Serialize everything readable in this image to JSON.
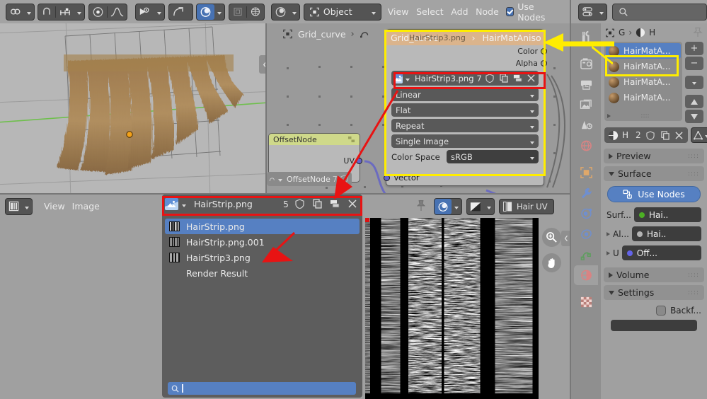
{
  "topbar": {
    "editor_icons": [
      "link-icon",
      "magnet-icon",
      "snap-icon",
      "proportional-edit-icon",
      "falloff-curve-icon",
      "visibility-icon",
      "pivot-icon",
      "overlay-icon",
      "xray-icon",
      "shading-icon"
    ],
    "shading_label": "",
    "mode_selector": "Object",
    "menus": [
      "View",
      "Select",
      "Add",
      "Node"
    ],
    "use_nodes_label": "Use Nodes",
    "use_nodes_checked": true,
    "right_editor_icon": "properties-editor-icon",
    "search_placeholder": ""
  },
  "viewport": {
    "collapse_icon": "chevron-left-icon"
  },
  "node_editor": {
    "breadcrumb": {
      "object_icon": "object-icon",
      "object": "Grid_curve",
      "arrow": "›",
      "modifier_icon": "nodetree-icon"
    },
    "header_path": {
      "left": "Grid_curve",
      "overlay": "HairStrip3.png",
      "sep": "›",
      "material": "HairMatAniso",
      "material_icon": "material-sphere-icon"
    },
    "image_node": {
      "outputs": [
        "Color",
        "Alpha"
      ],
      "image_name": "HairStrip3.png",
      "users": "7",
      "fields": [
        "Linear",
        "Flat",
        "Repeat",
        "Single Image"
      ],
      "color_space_label": "Color Space",
      "color_space_value": "sRGB",
      "input": "Vector",
      "icons": [
        "image-icon",
        "shield-icon",
        "copy-icon",
        "unpack-icon",
        "close-icon"
      ]
    },
    "offset_node": {
      "title": "OffsetNode",
      "output": "UV",
      "group_name": "OffsetNode",
      "group_users": "7"
    }
  },
  "image_editor": {
    "editor_type_icon": "image-editor-icon",
    "menus": [
      "View",
      "Image"
    ],
    "datablock": {
      "image_name": "HairStrip.png",
      "users": "5",
      "icons": [
        "image-icon",
        "shield-icon",
        "copy-icon",
        "unpack-icon",
        "close-icon"
      ]
    },
    "popup_items": [
      {
        "label": "HairStrip.png",
        "selected": true,
        "has_thumb": true
      },
      {
        "label": "HairStrip.png.001",
        "selected": false,
        "has_thumb": true
      },
      {
        "label": "HairStrip3.png",
        "selected": false,
        "has_thumb": true
      },
      {
        "label": "Render Result",
        "selected": false,
        "has_thumb": false
      }
    ],
    "search_placeholder": "",
    "preview_toolbar": {
      "shading_icon": "shading-icon",
      "view_mode_icon": "alpha-icon",
      "uv_icon": "uv-layer-icon",
      "uv_label": "Hair UV"
    },
    "right_tools": [
      "zoom-icon",
      "pan-hand-icon"
    ],
    "pin_icon": "pin-icon"
  },
  "properties": {
    "tabs": [
      {
        "name": "tool-tab",
        "icon": "tool-icon",
        "active": false
      },
      {
        "name": "render-tab",
        "icon": "camera-back-icon",
        "active": false
      },
      {
        "name": "output-tab",
        "icon": "printer-icon",
        "active": false
      },
      {
        "name": "viewlayer-tab",
        "icon": "images-icon",
        "active": false
      },
      {
        "name": "scene-tab",
        "icon": "scene-cone-icon",
        "active": false
      },
      {
        "name": "world-tab",
        "icon": "world-globe-icon",
        "active": false
      },
      {
        "name": "object-tab",
        "icon": "object-square-icon",
        "active": false
      },
      {
        "name": "modifier-tab",
        "icon": "wrench-icon",
        "active": false
      },
      {
        "name": "particles-tab",
        "icon": "particles-icon",
        "active": false
      },
      {
        "name": "physics-tab",
        "icon": "physics-icon",
        "active": false
      },
      {
        "name": "constraints-tab",
        "icon": "constraint-icon",
        "active": false
      },
      {
        "name": "material-tab",
        "icon": "material-sphere-icon",
        "active": true
      },
      {
        "name": "texture-tab",
        "icon": "checker-texture-icon",
        "active": false
      }
    ],
    "breadcrumb": {
      "object_icon": "object-icon",
      "object": "G",
      "sep": "›",
      "material_icon": "material-sphere-icon",
      "material": "H",
      "pin_icon": "pin-icon"
    },
    "material_slots": [
      {
        "label": "HairMatA...",
        "selected": true
      },
      {
        "label": "HairMatA...",
        "selected": false
      },
      {
        "label": "HairMatA...",
        "selected": false
      },
      {
        "label": "HairMatA...",
        "selected": false
      }
    ],
    "slot_buttons": [
      "+",
      "−",
      "chevron-down-icon",
      "up-arrow-icon",
      "down-arrow-icon"
    ],
    "datablock": {
      "material_icon": "material-sphere-icon",
      "name": "H",
      "users": "2",
      "icons": [
        "shield-icon",
        "copy-icon",
        "close-icon"
      ],
      "browse_icon": "triangle-mesh-icon"
    },
    "panels": [
      {
        "label": "Preview",
        "open": false
      },
      {
        "label": "Surface",
        "open": true
      },
      {
        "label": "Volume",
        "open": false
      },
      {
        "label": "Settings",
        "open": true
      }
    ],
    "use_nodes_button": "Use Nodes",
    "use_nodes_icon": "nodes-icon",
    "surface_rows": [
      {
        "label": "Surf...",
        "value": "Hai..",
        "dot": "#4caf24",
        "expandable": false
      },
      {
        "label": "Al...",
        "value": "Hai..",
        "dot": "#b4b4b4",
        "expandable": true
      },
      {
        "label": "U",
        "value": "Off...",
        "dot": "#6363e8",
        "expandable": true
      }
    ],
    "settings": {
      "backface_label": "Backf...",
      "backface_checked": false
    }
  },
  "annotations": {
    "yellow_box_node": "node-editor-material-highlight",
    "yellow_box_material_slot": "material-slot-highlight",
    "yellow_arrow": "pointer-to-material-header",
    "red_box_image_node": "image-node-datablock-highlight",
    "red_box_image_editor": "image-editor-datablock-highlight",
    "red_arrow_node_to_editor": "link-node-image-to-editor",
    "red_arrow_to_list_item": "pointer-to-hairstrip3"
  },
  "colors": {
    "accent_blue": "#5680c2",
    "highlight_yellow": "#ffed00",
    "highlight_red": "#e81313",
    "node_header_tan": "#dbb48c",
    "node_header_green": "#cfd98a",
    "bg_grey": "#a0a0a0"
  }
}
